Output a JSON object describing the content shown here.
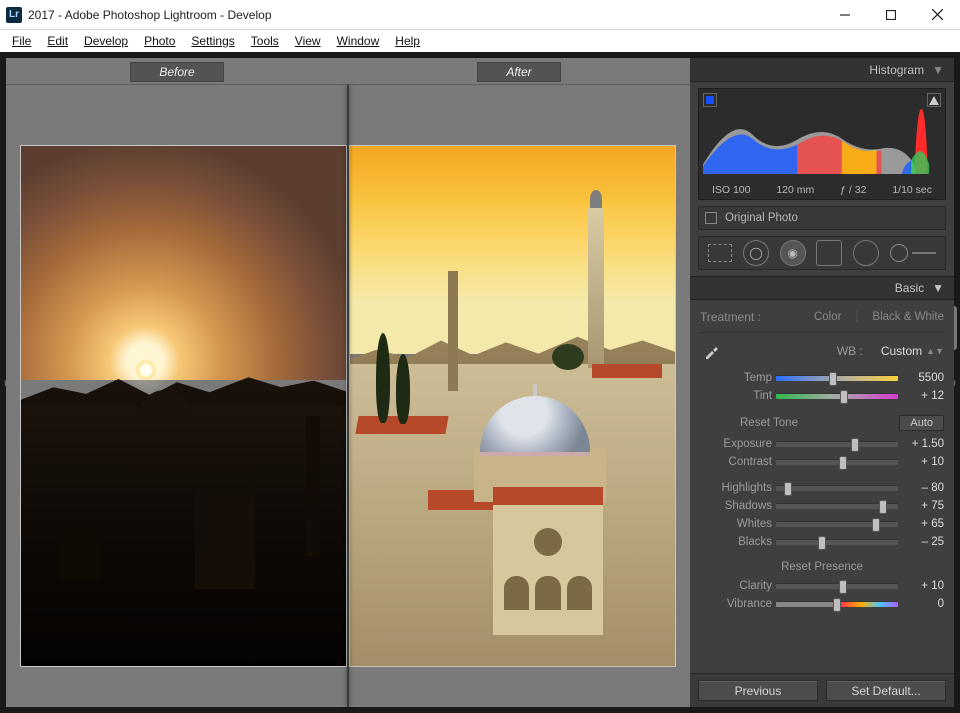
{
  "window": {
    "title": "2017 - Adobe Photoshop Lightroom - Develop",
    "icon_label": "Lr"
  },
  "menu": [
    "File",
    "Edit",
    "Develop",
    "Photo",
    "Settings",
    "Tools",
    "View",
    "Window",
    "Help"
  ],
  "compare": {
    "before": "Before",
    "after": "After"
  },
  "histogram": {
    "title": "Histogram",
    "iso": "ISO 100",
    "focal": "120 mm",
    "aperture": "ƒ / 32",
    "shutter": "1/10 sec",
    "original_photo": "Original Photo"
  },
  "basic": {
    "title": "Basic",
    "treatment_label": "Treatment :",
    "color": "Color",
    "bw": "Black & White",
    "wb_label": "WB :",
    "wb_value": "Custom",
    "reset_tone": "Reset Tone",
    "auto": "Auto",
    "reset_presence": "Reset Presence",
    "sliders": {
      "temp": {
        "label": "Temp",
        "value": "5500",
        "pos": 47
      },
      "tint": {
        "label": "Tint",
        "value": "+ 12",
        "pos": 56
      },
      "exposure": {
        "label": "Exposure",
        "value": "+ 1.50",
        "pos": 65
      },
      "contrast": {
        "label": "Contrast",
        "value": "+ 10",
        "pos": 55
      },
      "highlights": {
        "label": "Highlights",
        "value": "– 80",
        "pos": 10
      },
      "shadows": {
        "label": "Shadows",
        "value": "+ 75",
        "pos": 88
      },
      "whites": {
        "label": "Whites",
        "value": "+ 65",
        "pos": 82
      },
      "blacks": {
        "label": "Blacks",
        "value": "– 25",
        "pos": 38
      },
      "clarity": {
        "label": "Clarity",
        "value": "+ 10",
        "pos": 55
      },
      "vibrance": {
        "label": "Vibrance",
        "value": "0",
        "pos": 50
      }
    }
  },
  "buttons": {
    "previous": "Previous",
    "set_default": "Set Default..."
  }
}
